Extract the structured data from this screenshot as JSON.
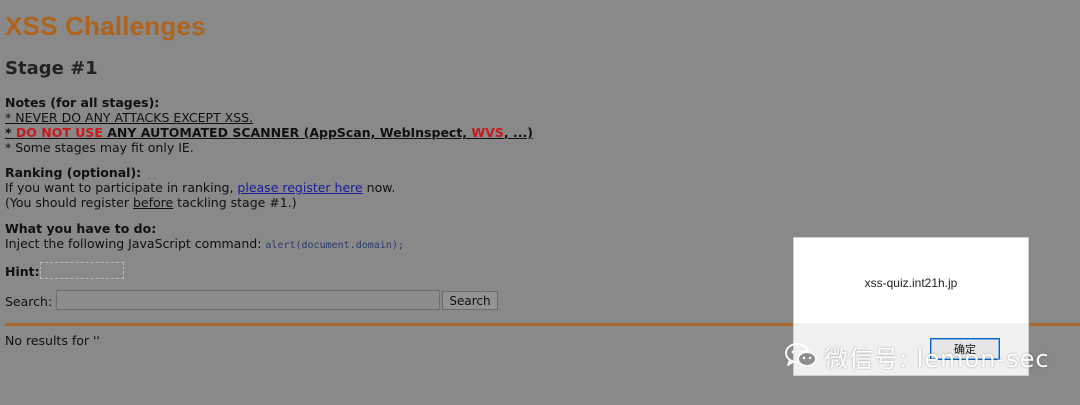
{
  "header": {
    "title": "XSS Challenges",
    "stage": "Stage #1"
  },
  "notes": {
    "heading": "Notes (for all stages):",
    "line1": "* NEVER DO ANY ATTACKS EXCEPT XSS.",
    "line2_prefix": "* ",
    "line2_red": "DO NOT USE",
    "line2_mid": " ANY AUTOMATED SCANNER (AppScan, WebInspect, ",
    "line2_wvs": "WVS",
    "line2_end": ", ...)",
    "line3": "* Some stages may fit only IE."
  },
  "ranking": {
    "heading": "Ranking (optional):",
    "line1_before": "If you want to participate in ranking, ",
    "line1_link": "please register here",
    "line1_after": " now.",
    "line2_before": "(You should register ",
    "line2_u": "before",
    "line2_after": " tackling stage #1.)"
  },
  "task": {
    "heading": "What you have to do:",
    "text": "Inject the following JavaScript command: ",
    "code": "alert(document.domain);"
  },
  "hint": {
    "label": "Hint:"
  },
  "search": {
    "label": "Search:",
    "value": "",
    "button": "Search"
  },
  "result": {
    "text": "No results for ''"
  },
  "dialog": {
    "message": "xss-quiz.int21h.jp",
    "ok": "确定"
  },
  "watermark": {
    "text": "微信号: lemon-sec"
  },
  "colors": {
    "title": "#b0631c",
    "warning": "#c8191e",
    "link": "#1c1ca0",
    "overlay": "#898989"
  }
}
